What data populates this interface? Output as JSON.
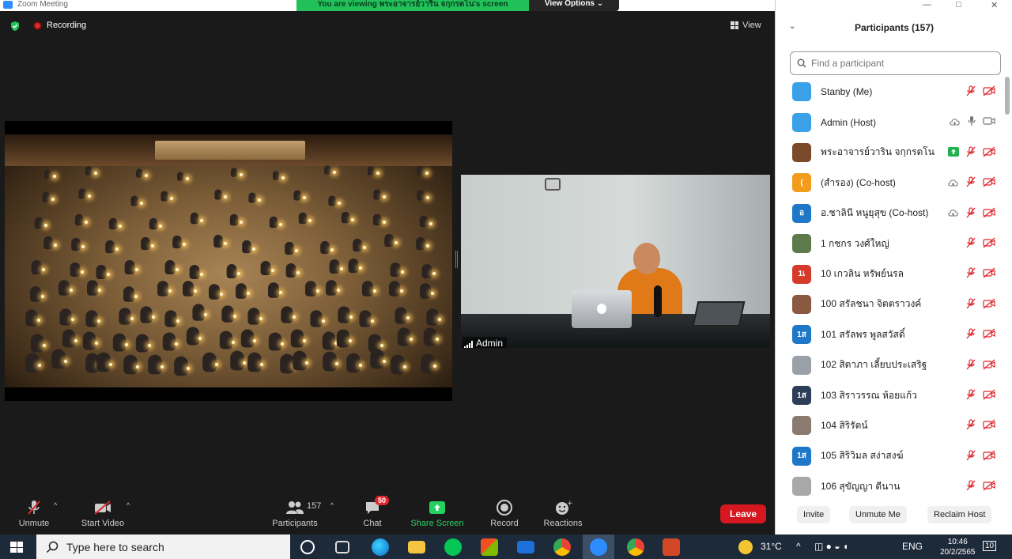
{
  "window": {
    "title": "Zoom Meeting",
    "viewing_banner": "You are viewing พระอาจารย์วาริน จกฺกรตโน's screen",
    "view_options": "View Options",
    "minimize": "—",
    "maximize": "□",
    "close": "✕"
  },
  "meeting": {
    "recording_label": "Recording",
    "view_label": "View",
    "camera_name": "Admin"
  },
  "toolbar": {
    "unmute": "Unmute",
    "start_video": "Start Video",
    "participants": "Participants",
    "participant_count": "157",
    "chat": "Chat",
    "chat_badge": "50",
    "share_screen": "Share Screen",
    "record": "Record",
    "reactions": "Reactions",
    "leave": "Leave"
  },
  "panel": {
    "title": "Participants (157)",
    "search_placeholder": "Find a participant",
    "participants": [
      {
        "name": "Stanby (Me)",
        "avatar_text": "",
        "avatar_color": "#3aa0e8",
        "icons": [
          "mic-muted",
          "video-off"
        ]
      },
      {
        "name": "Admin (Host)",
        "avatar_text": "",
        "avatar_color": "#3aa0e8",
        "icons": [
          "cloud",
          "mic",
          "video"
        ]
      },
      {
        "name": "พระอาจารย์วาริน จกฺกรตโน",
        "avatar_text": "",
        "avatar_color": "#7a4a2a",
        "icons": [
          "share",
          "mic-muted",
          "video-off"
        ]
      },
      {
        "name": "(สำรอง) (Co-host)",
        "avatar_text": "(",
        "avatar_color": "#f19c1a",
        "icons": [
          "cloud",
          "mic-muted",
          "video-off"
        ]
      },
      {
        "name": "อ.ชาลินี หนูยุสุข (Co-host)",
        "avatar_text": "อ",
        "avatar_color": "#1f77c8",
        "icons": [
          "cloud",
          "mic-muted",
          "video-off"
        ]
      },
      {
        "name": "1 กชกร วงศ์ใหญ่",
        "avatar_text": "",
        "avatar_color": "#5f7a4a",
        "icons": [
          "mic-muted",
          "video-off"
        ]
      },
      {
        "name": "10 เกวลิน หรัพย์นรล",
        "avatar_text": "1เ",
        "avatar_color": "#d63a2a",
        "icons": [
          "mic-muted",
          "video-off"
        ]
      },
      {
        "name": "100 สรัลชนา จิตตราวงค์",
        "avatar_text": "",
        "avatar_color": "#8a5a40",
        "icons": [
          "mic-muted",
          "video-off"
        ]
      },
      {
        "name": "101 สรัลพร พูลสวัสดิ์",
        "avatar_text": "1ส",
        "avatar_color": "#1f77c8",
        "icons": [
          "mic-muted",
          "video-off"
        ]
      },
      {
        "name": "102 สิตาภา เลี้ยบประเสริฐ",
        "avatar_text": "",
        "avatar_color": "#9aa0a8",
        "icons": [
          "mic-muted",
          "video-off"
        ]
      },
      {
        "name": "103 สิราวรรณ ห้อยแก้ว",
        "avatar_text": "1ส",
        "avatar_color": "#2c3e58",
        "icons": [
          "mic-muted",
          "video-off"
        ]
      },
      {
        "name": "104 สิริรัตน์",
        "avatar_text": "",
        "avatar_color": "#8a7a70",
        "icons": [
          "mic-muted",
          "video-off"
        ]
      },
      {
        "name": "105 สิริวิมล สง่าสงฆ์",
        "avatar_text": "1ส",
        "avatar_color": "#1f77c8",
        "icons": [
          "mic-muted",
          "video-off"
        ]
      },
      {
        "name": "106 สุขัญญา ดีนาน",
        "avatar_text": "",
        "avatar_color": "#a8a8a8",
        "icons": [
          "mic-muted",
          "video-off"
        ]
      }
    ],
    "invite": "Invite",
    "unmute_me": "Unmute Me",
    "reclaim_host": "Reclaim Host"
  },
  "taskbar": {
    "search_placeholder": "Type here to search",
    "temperature": "31°C",
    "language": "ENG",
    "time": "10:46",
    "date": "20/2/2565",
    "notifications": "10"
  },
  "colors": {
    "zoom_blue": "#2d8cff",
    "share_green": "#23d160",
    "leave_red": "#d5181f",
    "mute_red": "#e0262c"
  }
}
